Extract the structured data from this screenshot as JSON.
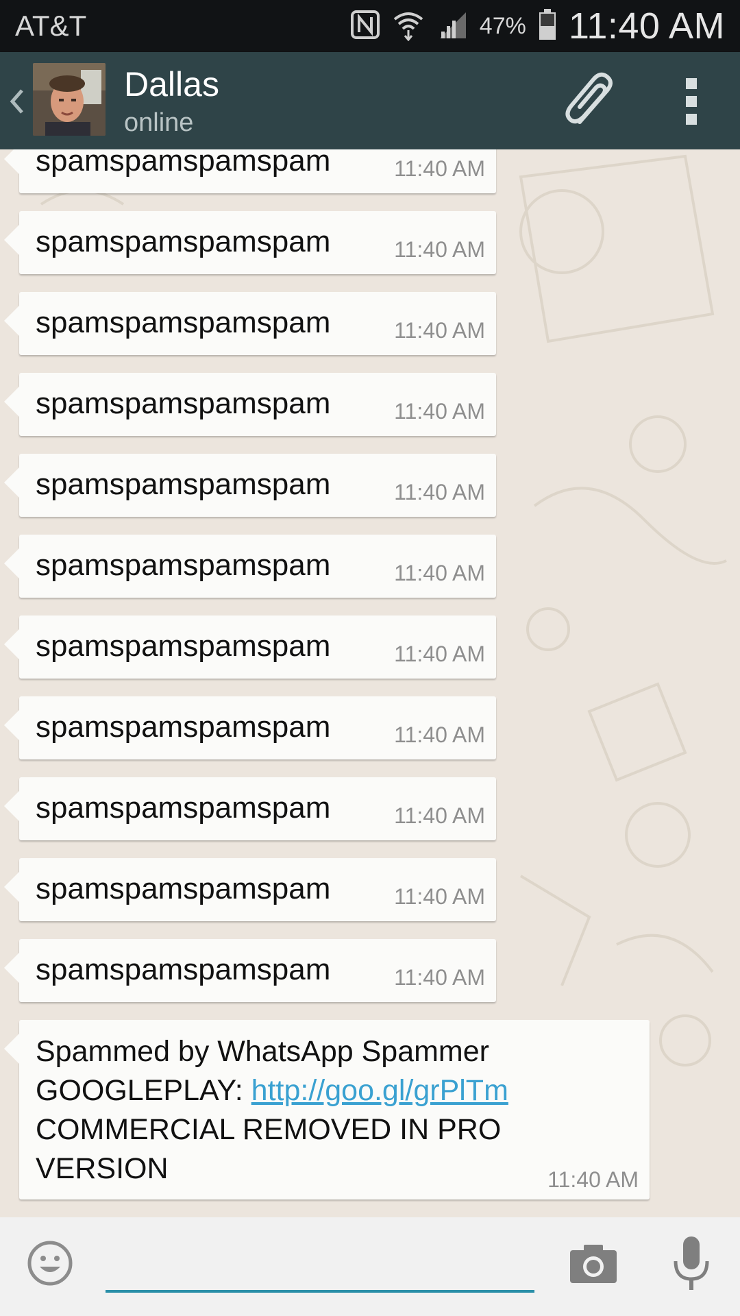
{
  "status_bar": {
    "carrier": "AT&T",
    "battery": "47%",
    "time": "11:40 AM",
    "icons": [
      "nfc-icon",
      "wifi-icon",
      "signal-icon",
      "battery-icon"
    ]
  },
  "header": {
    "back_icon": "back-chevron-icon",
    "contact_name": "Dallas",
    "contact_status": "online",
    "attach_icon": "paperclip-icon",
    "menu_icon": "overflow-menu-icon"
  },
  "messages": [
    {
      "text": "spamspamspamspam",
      "time": "11:40 AM"
    },
    {
      "text": "spamspamspamspam",
      "time": "11:40 AM"
    },
    {
      "text": "spamspamspamspam",
      "time": "11:40 AM"
    },
    {
      "text": "spamspamspamspam",
      "time": "11:40 AM"
    },
    {
      "text": "spamspamspamspam",
      "time": "11:40 AM"
    },
    {
      "text": "spamspamspamspam",
      "time": "11:40 AM"
    },
    {
      "text": "spamspamspamspam",
      "time": "11:40 AM"
    },
    {
      "text": "spamspamspamspam",
      "time": "11:40 AM"
    },
    {
      "text": "spamspamspamspam",
      "time": "11:40 AM"
    },
    {
      "text": "spamspamspamspam",
      "time": "11:40 AM"
    },
    {
      "text": "spamspamspamspam",
      "time": "11:40 AM"
    }
  ],
  "promo_message": {
    "line1": "Spammed by WhatsApp Spammer",
    "line2_prefix": "GOOGLEPLAY: ",
    "link": "http://goo.gl/grPlTm",
    "line3": "COMMERCIAL REMOVED IN PRO",
    "line4": "VERSION",
    "time": "11:40 AM"
  },
  "input_bar": {
    "value": "",
    "emoji_icon": "emoji-icon",
    "camera_icon": "camera-icon",
    "mic_icon": "microphone-icon"
  },
  "colors": {
    "status_bar": "#111315",
    "header": "#2f4448",
    "chat_background": "#ece5dd",
    "bubble": "#fbfbf9",
    "link": "#3aa1d1",
    "input_underline": "#2a8fa8"
  }
}
